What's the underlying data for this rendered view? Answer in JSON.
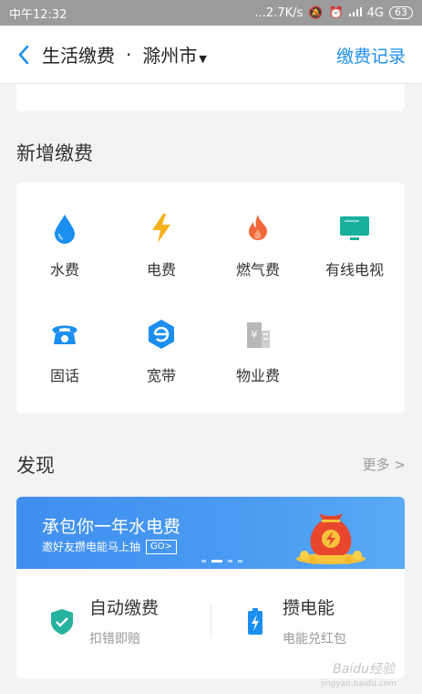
{
  "status_bar": {
    "time": "中午12:32",
    "speed": "...2.7K/s",
    "network": "4G",
    "battery": "63"
  },
  "nav": {
    "title": "生活缴费",
    "separator": "·",
    "city": "滁州市",
    "right_link": "缴费记录"
  },
  "new_payment": {
    "title": "新增缴费",
    "items": [
      {
        "label": "水费",
        "icon": "water-drop-icon",
        "color": "#1b8ff0"
      },
      {
        "label": "电费",
        "icon": "lightning-icon",
        "color": "#f6b21b"
      },
      {
        "label": "燃气费",
        "icon": "flame-icon",
        "color": "#f2683b"
      },
      {
        "label": "有线电视",
        "icon": "tv-icon",
        "color": "#18b09b"
      },
      {
        "label": "固话",
        "icon": "telephone-icon",
        "color": "#1b8ff0"
      },
      {
        "label": "宽带",
        "icon": "broadband-icon",
        "color": "#1b8ff0"
      },
      {
        "label": "物业费",
        "icon": "building-icon",
        "color": "#b8b8b8"
      }
    ]
  },
  "discover": {
    "title": "发现",
    "more": "更多 >",
    "banner": {
      "title": "承包你一年水电费",
      "subtitle": "邀好友攒电能马上抽",
      "go": "GO>",
      "icon": "money-bag-icon"
    },
    "services": [
      {
        "title": "自动缴费",
        "subtitle": "扣错即赔",
        "icon": "shield-check-icon",
        "color": "#25b39e"
      },
      {
        "title": "攒电能",
        "subtitle": "电能兑红包",
        "icon": "battery-icon",
        "color": "#1b8ff0"
      }
    ]
  },
  "watermark": {
    "text": "Baidu经验",
    "sub": "jingyan.baidu.com"
  }
}
